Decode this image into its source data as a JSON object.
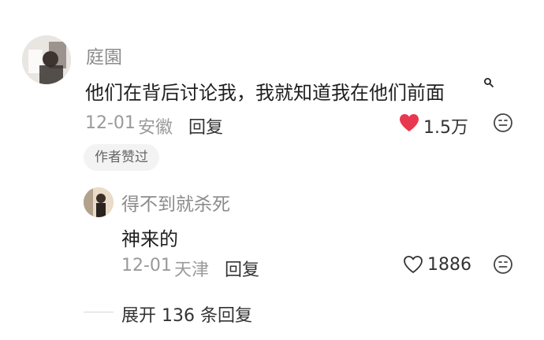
{
  "comment": {
    "author": "庭園",
    "text": "他们在背后讨论我，我就知道我在他们前面",
    "date": "12-01",
    "location": "安徽",
    "reply_label": "回复",
    "likes": "1.5万",
    "liked": true,
    "author_liked_badge": "作者赞过"
  },
  "reply": {
    "author": "得不到就杀死",
    "text": "神来的",
    "date": "12-01",
    "location": "天津",
    "reply_label": "回复",
    "likes": "1886",
    "liked": false
  },
  "expand_replies_label": "展开 136 条回复",
  "colors": {
    "like_active": "#e8384f",
    "meta_gray": "#9a9a9a"
  }
}
